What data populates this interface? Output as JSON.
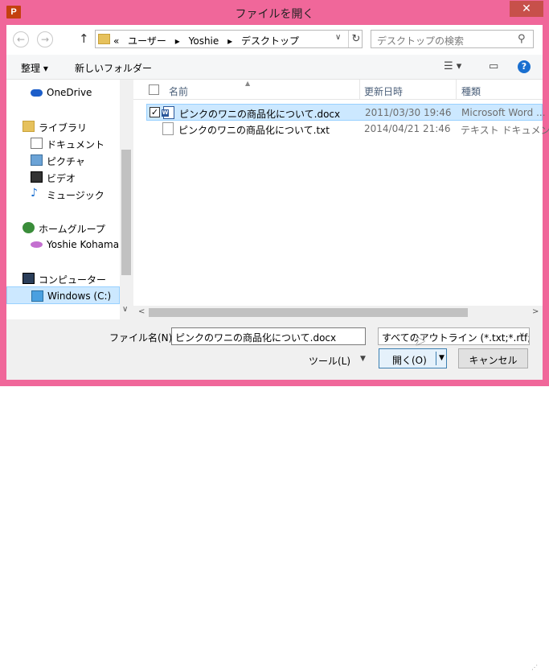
{
  "window": {
    "title": "ファイルを開く",
    "app_icon": "P",
    "close_label": "✕"
  },
  "nav": {
    "back_icon": "←",
    "forward_icon": "→",
    "up_icon": "↑",
    "address": {
      "prefix": "«",
      "crumbs": [
        "ユーザー",
        "Yoshie",
        "デスクトップ"
      ],
      "separator": "▸",
      "dropdown": "∨",
      "refresh": "↻"
    },
    "search_placeholder": "デスクトップの検索",
    "search_icon": "⚲"
  },
  "toolbar": {
    "organize": "整理 ▾",
    "new_folder": "新しいフォルダー",
    "view_icon": "☰ ▾",
    "pane_icon": "▭",
    "help": "?"
  },
  "sidebar": {
    "items": [
      {
        "label": "OneDrive",
        "icon": "cloud-icon"
      },
      {
        "label": "ライブラリ",
        "icon": "library-icon"
      },
      {
        "label": "ドキュメント",
        "icon": "document-icon"
      },
      {
        "label": "ピクチャ",
        "icon": "picture-icon"
      },
      {
        "label": "ビデオ",
        "icon": "video-icon"
      },
      {
        "label": "ミュージック",
        "icon": "music-icon"
      },
      {
        "label": "ホームグループ",
        "icon": "homegroup-icon"
      },
      {
        "label": "Yoshie Kohama",
        "icon": "user-icon"
      },
      {
        "label": "コンピューター",
        "icon": "computer-icon"
      },
      {
        "label": "Windows (C:)",
        "icon": "drive-icon"
      }
    ]
  },
  "files": {
    "columns": [
      "名前",
      "更新日時",
      "種類"
    ],
    "rows": [
      {
        "name": "ピンクのワニの商品化について.docx",
        "date": "2011/03/30 19:46",
        "type": "Microsoft Word ...",
        "checked": "✓"
      },
      {
        "name": "ピンクのワニの商品化について.txt",
        "date": "2014/04/21 21:46",
        "type": "テキスト ドキュメント",
        "checked": ""
      }
    ]
  },
  "bottom": {
    "filename_label": "ファイル名(N):",
    "filename_value": "ピンクのワニの商品化について.docx",
    "filetype_value": "すべてのアウトライン (*.txt;*.rtf;",
    "tools": "ツール(L)",
    "open": "開く(O)",
    "cancel": "キャンセル"
  },
  "colors": {
    "frame": "#f0679a",
    "selection": "#cce8ff",
    "selection_border": "#99d1ff"
  }
}
